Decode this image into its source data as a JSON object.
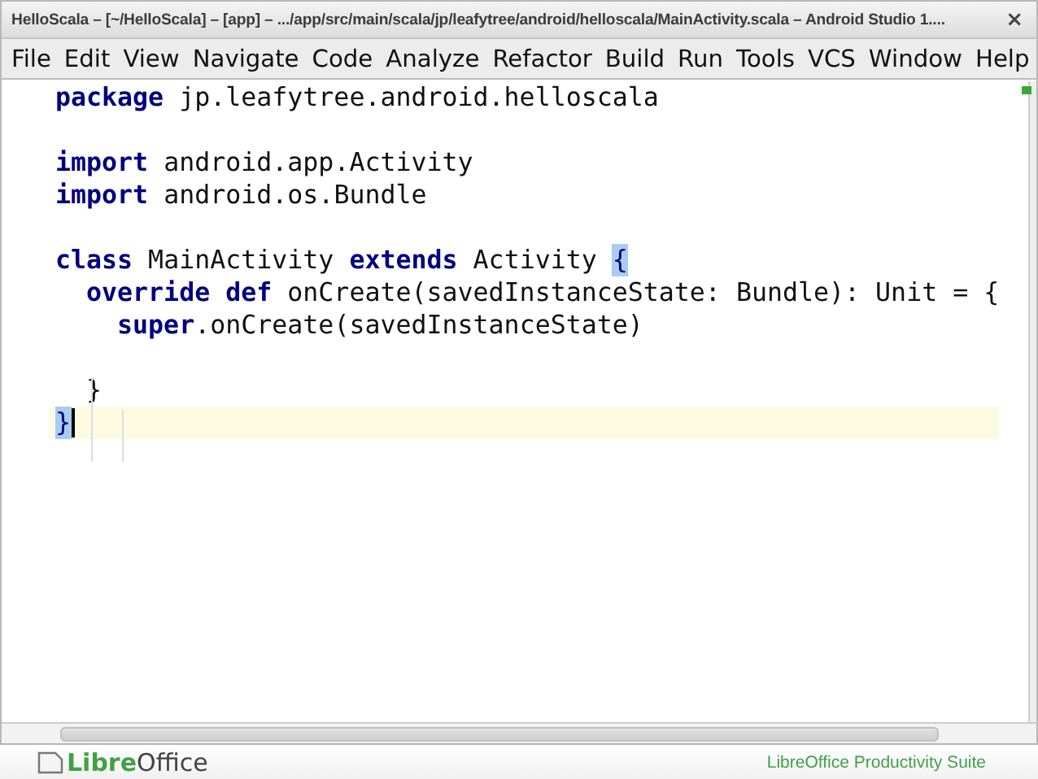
{
  "window": {
    "title": "HelloScala – [~/HelloScala] – [app] – .../app/src/main/scala/jp/leafytree/android/helloscala/MainActivity.scala – Android Studio 1....",
    "close": "×"
  },
  "menu": [
    "File",
    "Edit",
    "View",
    "Navigate",
    "Code",
    "Analyze",
    "Refactor",
    "Build",
    "Run",
    "Tools",
    "VCS",
    "Window",
    "Help"
  ],
  "editor": {
    "lines": [
      {
        "current": false,
        "tokens": [
          {
            "kind": "keyword",
            "text": "package"
          },
          {
            "kind": "plain",
            "text": " jp.leafytree.android.helloscala"
          }
        ]
      },
      {
        "current": false
      },
      {
        "current": false,
        "tokens": [
          {
            "kind": "keyword",
            "text": "import"
          },
          {
            "kind": "plain",
            "text": " android.app.Activity"
          }
        ]
      },
      {
        "current": false,
        "tokens": [
          {
            "kind": "keyword",
            "text": "import"
          },
          {
            "kind": "plain",
            "text": " android.os.Bundle"
          }
        ]
      },
      {
        "current": false
      },
      {
        "current": false,
        "tokens": [
          {
            "kind": "keyword",
            "text": "class"
          },
          {
            "kind": "plain",
            "text": " MainActivity "
          },
          {
            "kind": "keyword",
            "text": "extends"
          },
          {
            "kind": "plain",
            "text": " Activity "
          },
          {
            "kind": "brace_match",
            "text": "{"
          }
        ]
      },
      {
        "current": false,
        "tokens": [
          {
            "kind": "keyword",
            "text": "  override def"
          },
          {
            "kind": "plain",
            "text": " onCreate(savedInstanceState: Bundle): Unit = {"
          }
        ]
      },
      {
        "current": false,
        "tokens": [
          {
            "kind": "keyword",
            "text": "    super"
          },
          {
            "kind": "plain",
            "text": ".onCreate(savedInstanceState)"
          }
        ]
      },
      {
        "current": false
      },
      {
        "current": false,
        "tokens": [
          {
            "kind": "plain",
            "text": "  }"
          }
        ]
      },
      {
        "current": true,
        "tokens": [
          {
            "kind": "brace_match",
            "text": "}"
          }
        ]
      }
    ]
  },
  "footer": {
    "logo_bold": "Libre",
    "logo_rest": "Office",
    "tagline": "LibreOffice Productivity Suite"
  }
}
